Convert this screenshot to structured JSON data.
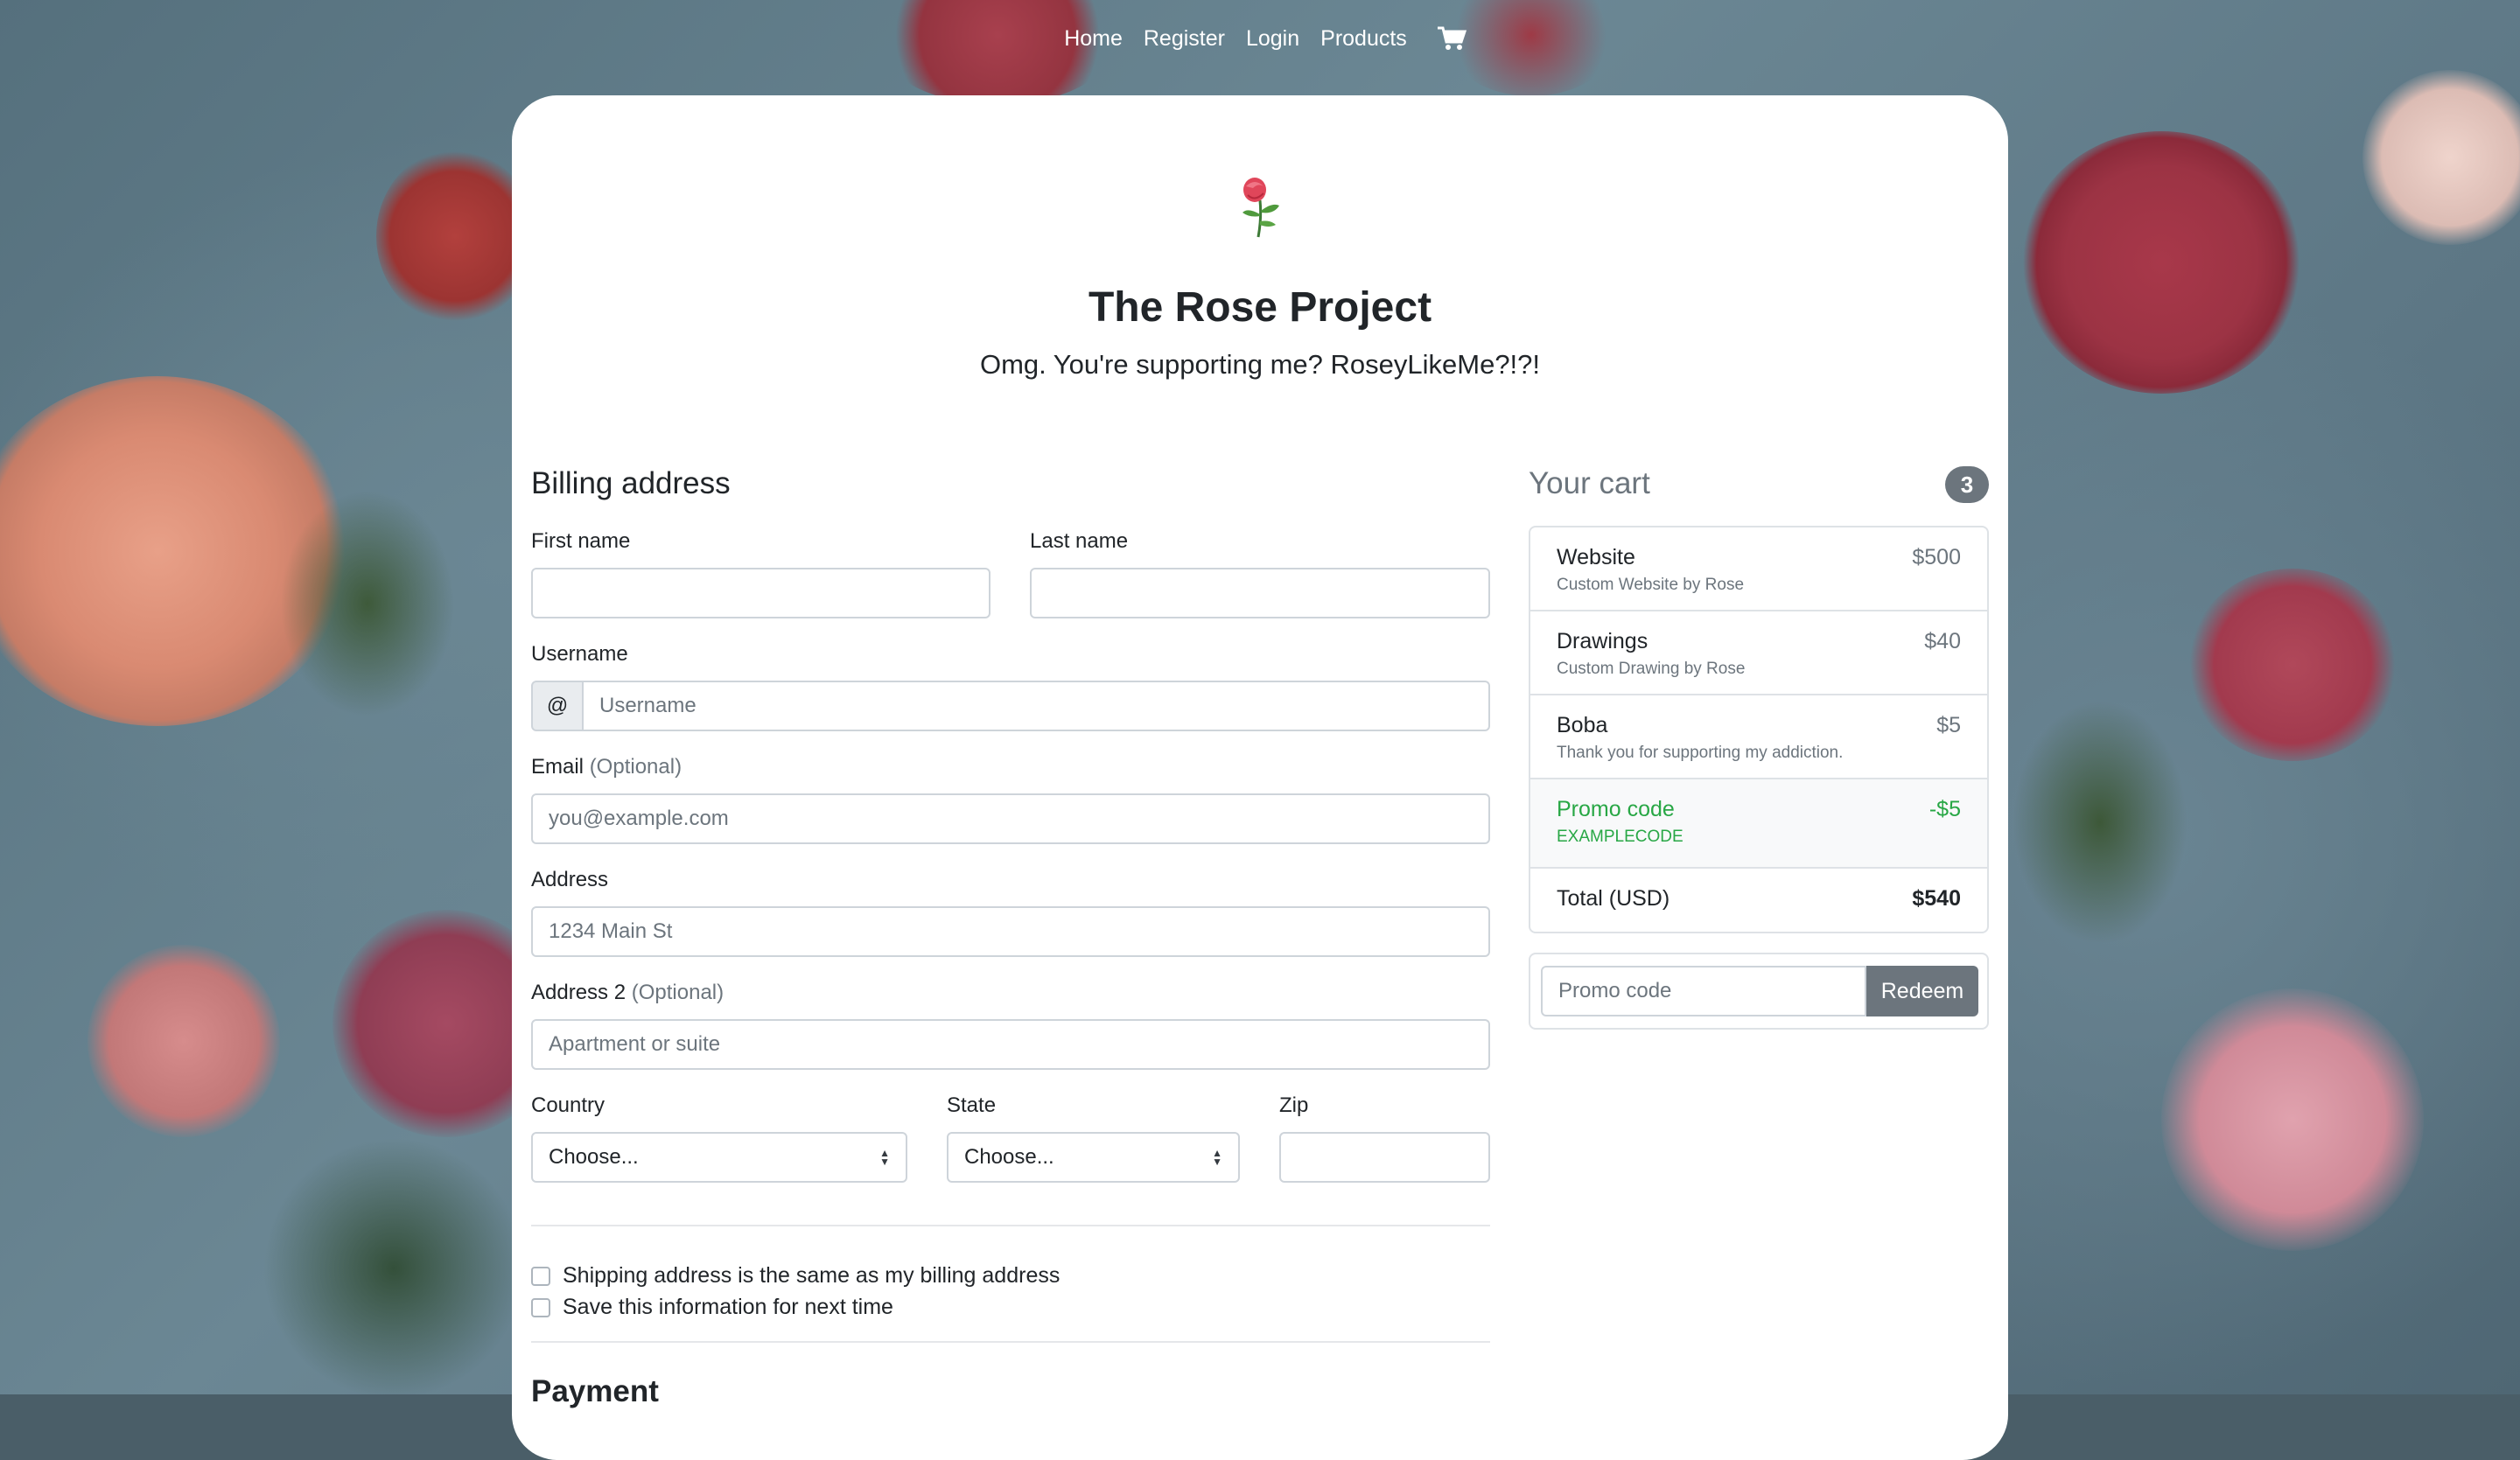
{
  "nav": {
    "items": [
      "Home",
      "Register",
      "Login",
      "Products"
    ],
    "cart_icon": "shopping-cart-icon"
  },
  "header": {
    "logo_icon": "rose-icon",
    "title": "The Rose Project",
    "subtitle": "Omg. You're supporting me? RoseyLikeMe?!?!"
  },
  "billing": {
    "heading": "Billing address",
    "first_name_label": "First name",
    "last_name_label": "Last name",
    "username_label": "Username",
    "username_prefix": "@",
    "username_placeholder": "Username",
    "email_label": "Email",
    "email_optional": "(Optional)",
    "email_placeholder": "you@example.com",
    "address_label": "Address",
    "address_placeholder": "1234 Main St",
    "address2_label": "Address 2",
    "address2_optional": "(Optional)",
    "address2_placeholder": "Apartment or suite",
    "country_label": "Country",
    "country_value": "Choose...",
    "state_label": "State",
    "state_value": "Choose...",
    "zip_label": "Zip",
    "shipping_same_label": "Shipping address is the same as my billing address",
    "save_info_label": "Save this information for next time",
    "payment_heading": "Payment"
  },
  "cart": {
    "title": "Your cart",
    "count": "3",
    "items": [
      {
        "name": "Website",
        "desc": "Custom Website by Rose",
        "price": "$500"
      },
      {
        "name": "Drawings",
        "desc": "Custom Drawing by Rose",
        "price": "$40"
      },
      {
        "name": "Boba",
        "desc": "Thank you for supporting my addiction.",
        "price": "$5"
      }
    ],
    "promo": {
      "name": "Promo code",
      "code": "EXAMPLECODE",
      "price": "-$5"
    },
    "total": {
      "label": "Total (USD)",
      "value": "$540"
    },
    "promo_placeholder": "Promo code",
    "redeem_label": "Redeem"
  },
  "colors": {
    "accent_muted": "#6c757d",
    "promo_green": "#28a745"
  }
}
